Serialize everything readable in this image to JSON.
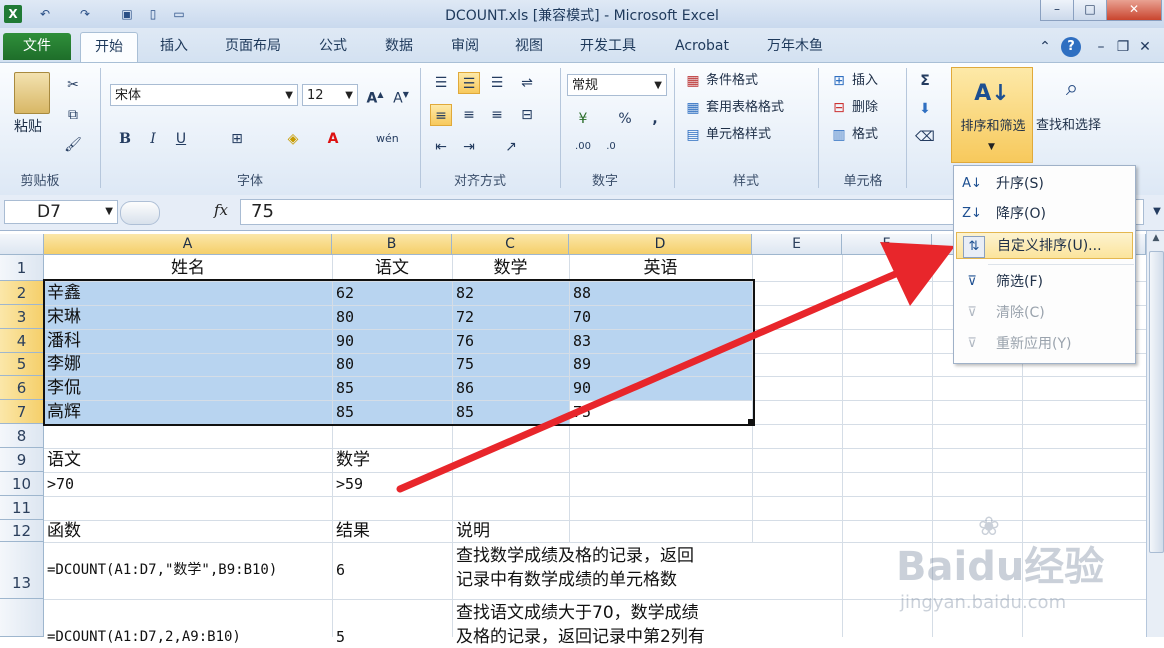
{
  "window": {
    "title": "DCOUNT.xls  [兼容模式] - Microsoft Excel"
  },
  "quick_access": [
    "excel-logo-icon",
    "undo-icon",
    "redo-icon",
    "save-icon",
    "new-icon",
    "open-icon"
  ],
  "tabs": [
    "文件",
    "开始",
    "插入",
    "页面布局",
    "公式",
    "数据",
    "审阅",
    "视图",
    "开发工具",
    "Acrobat",
    "万年木鱼"
  ],
  "ribbon": {
    "clipboard": {
      "paste": "粘贴",
      "label": "剪贴板"
    },
    "font": {
      "name": "宋体",
      "size": "12",
      "label": "字体"
    },
    "alignment": {
      "label": "对齐方式"
    },
    "number": {
      "format": "常规",
      "label": "数字"
    },
    "styles": {
      "conditional": "条件格式",
      "table": "套用表格格式",
      "cell": "单元格样式",
      "label": "样式"
    },
    "cells": {
      "insert": "插入",
      "delete": "删除",
      "format": "格式",
      "label": "单元格"
    },
    "editing": {
      "sort_filter": "排序和筛选",
      "find_select": "查找和选择"
    }
  },
  "formula_bar": {
    "name_box": "D7",
    "fx": "fx",
    "value": "75"
  },
  "columns": [
    "A",
    "B",
    "C",
    "D",
    "E",
    "F"
  ],
  "rows": [
    "1",
    "2",
    "3",
    "4",
    "5",
    "6",
    "7",
    "8",
    "9",
    "10",
    "11",
    "12",
    "13"
  ],
  "sheet": {
    "header": [
      "姓名",
      "语文",
      "数学",
      "英语"
    ],
    "data": [
      [
        "辛鑫",
        "62",
        "82",
        "88"
      ],
      [
        "宋琳",
        "80",
        "72",
        "70"
      ],
      [
        "潘科",
        "90",
        "76",
        "83"
      ],
      [
        "李娜",
        "80",
        "75",
        "89"
      ],
      [
        "李侃",
        "85",
        "86",
        "90"
      ],
      [
        "高辉",
        "85",
        "85",
        "75"
      ]
    ],
    "r9": [
      "语文",
      "数学"
    ],
    "r10": [
      ">70",
      ">59"
    ],
    "r12": [
      "函数",
      "结果",
      "说明"
    ],
    "r13": {
      "formula": "=DCOUNT(A1:D7,\"数学\",B9:B10)",
      "result": "6",
      "desc1": "查找数学成绩及格的记录，返回",
      "desc2": "记录中有数学成绩的单元格数"
    },
    "r14": {
      "formula": "=DCOUNT(A1:D7,2,A9:B10)",
      "result": "5",
      "desc1": "查找语文成绩大于70，数学成绩",
      "desc2": "及格的记录，返回记录中第2列有"
    }
  },
  "menu": {
    "items": [
      {
        "icon": "sort-ascending-icon",
        "label": "升序(S)",
        "disabled": false
      },
      {
        "icon": "sort-descending-icon",
        "label": "降序(O)",
        "disabled": false
      },
      {
        "icon": "custom-sort-icon",
        "label": "自定义排序(U)...",
        "disabled": false
      },
      {
        "icon": "filter-icon",
        "label": "筛选(F)",
        "disabled": false
      },
      {
        "icon": "clear-filter-icon",
        "label": "清除(C)",
        "disabled": true
      },
      {
        "icon": "reapply-icon",
        "label": "重新应用(Y)",
        "disabled": true
      }
    ]
  },
  "watermark": {
    "brand": "Baidu经验",
    "url": "jingyan.baidu.com"
  },
  "colors": {
    "selection": "#b8d4f0",
    "accent": "#f7c95c",
    "arrow": "#e8262b"
  }
}
